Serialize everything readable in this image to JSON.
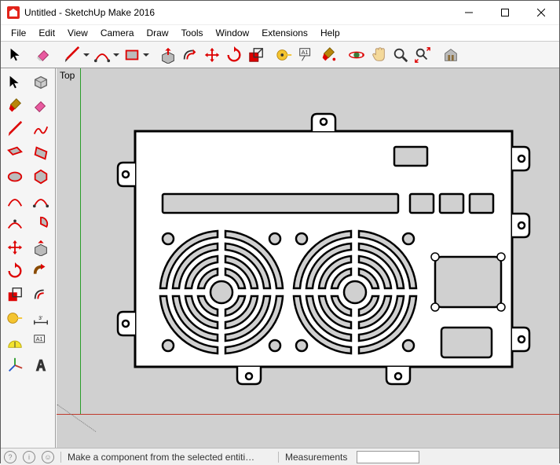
{
  "window": {
    "title": "Untitled - SketchUp Make 2016"
  },
  "menu": {
    "items": [
      "File",
      "Edit",
      "View",
      "Camera",
      "Draw",
      "Tools",
      "Window",
      "Extensions",
      "Help"
    ]
  },
  "viewport": {
    "label": "Top"
  },
  "status": {
    "hint": "Make a component from the selected entiti…",
    "measurements_label": "Measurements",
    "measurements_value": ""
  },
  "icons": {
    "question": "?",
    "info": "i",
    "user": "☺"
  }
}
